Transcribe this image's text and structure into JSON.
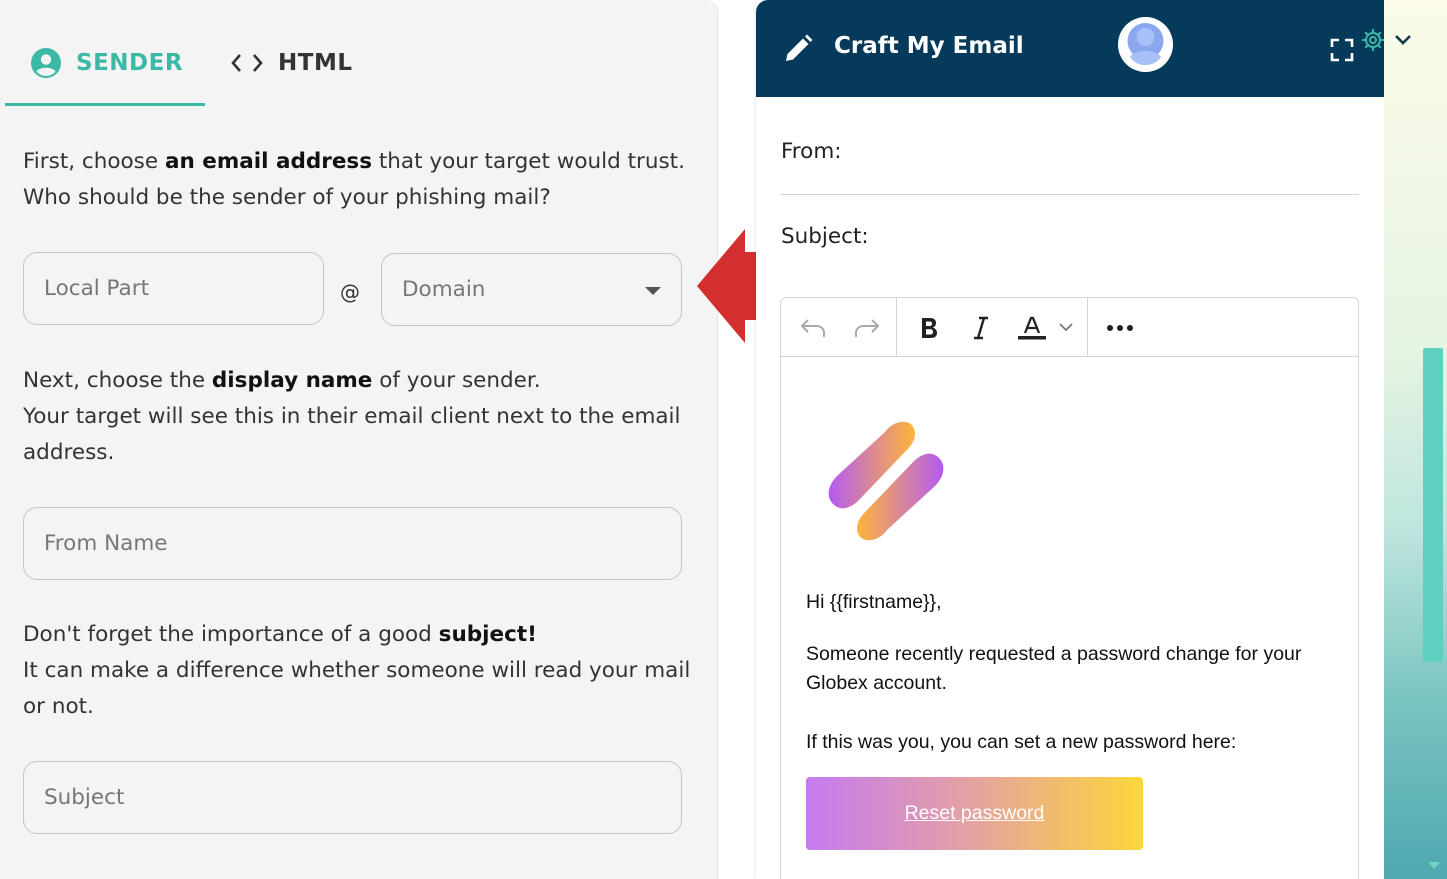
{
  "tabs": [
    {
      "label": "SENDER",
      "icon": "person-circle-icon"
    },
    {
      "label": "HTML",
      "icon": "code-icon"
    }
  ],
  "colors": {
    "accent": "#3bb9a6",
    "header_bg": "#053a5a",
    "arrow": "#d32f2f"
  },
  "sender": {
    "intro_pre": "First, choose ",
    "intro_bold": "an email address",
    "intro_post": " that your target would trust. Who should be the sender of your phishing mail?",
    "local_part_placeholder": "Local Part",
    "at": "@",
    "domain_placeholder": "Domain",
    "display_pre": "Next, choose the ",
    "display_bold": "display name",
    "display_post": " of your sender.",
    "display_line2": "Your target will see this in their email client next to the email address.",
    "from_name_placeholder": "From Name",
    "subject_pre": "Don't forget the importance of a good ",
    "subject_bold": "subject!",
    "subject_line2": "It can make a difference whether someone will read your mail or not.",
    "subject_placeholder": "Subject"
  },
  "preview": {
    "title": "Craft My Email",
    "from_label": "From:",
    "subject_label": "Subject:",
    "greeting": "Hi {{firstname}},",
    "para1": "Someone recently requested a password change for your Globex account.",
    "para2": "If this was you, you can set a new password here:",
    "button": "Reset password"
  }
}
